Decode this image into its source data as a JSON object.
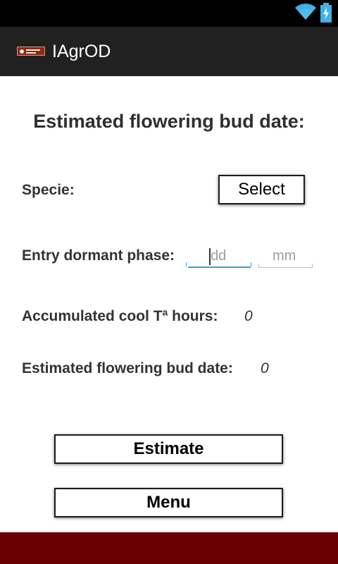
{
  "status_bar": {
    "wifi_icon": "wifi-icon",
    "battery_icon": "battery-charging-icon",
    "accent": "#3fb1e6"
  },
  "action_bar": {
    "logo_text": "IAgrOD",
    "title": "IAgrOD"
  },
  "form": {
    "heading": "Estimated flowering bud date:",
    "specie_label": "Specie:",
    "select_label": "Select",
    "entry_label": "Entry dormant phase:",
    "day_placeholder": "dd",
    "month_placeholder": "mm",
    "cool_hours_label": "Accumulated cool Tª hours:",
    "cool_hours_value": "0",
    "bud_date_label": "Estimated flowering bud date:",
    "bud_date_value": "0"
  },
  "buttons": {
    "estimate_label": "Estimate",
    "menu_label": "Menu"
  },
  "colors": {
    "action_bar": "#212121",
    "footer": "#6a0000",
    "focus_underline": "#31a6cf"
  }
}
